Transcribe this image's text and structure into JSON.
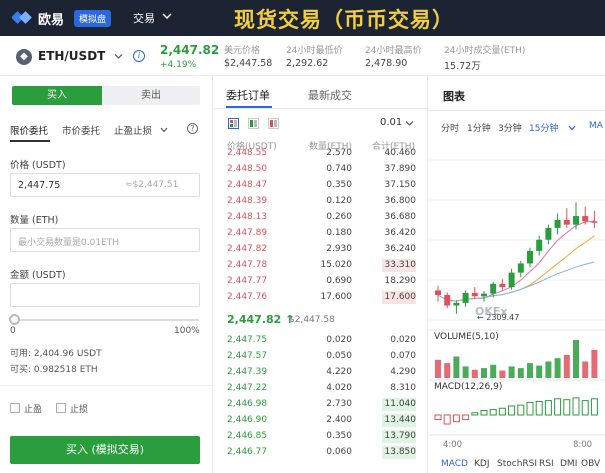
{
  "app": {
    "logo_text": "欧易",
    "demo_badge": "模拟盘",
    "nav_trade": "交易",
    "banner_title": "现货交易（币币交易）"
  },
  "ticker": {
    "pair": "ETH/USDT",
    "last_price": "2,447.82",
    "change_pct": "+4.19%",
    "stats": [
      {
        "label": "美元价格",
        "value": "$2,447.58"
      },
      {
        "label": "24小时最低价",
        "value": "2,292.62"
      },
      {
        "label": "24小时最高价",
        "value": "2,478.90"
      },
      {
        "label": "24小时成交量(ETH)",
        "value": "15.72万"
      }
    ]
  },
  "order_form": {
    "buy_tab": "买入",
    "sell_tab": "卖出",
    "order_types": [
      "限价委托",
      "市价委托",
      "止盈止损"
    ],
    "price_label": "价格 (USDT)",
    "price_value": "2,447.75",
    "price_approx": "≈$2,447.51",
    "amount_label": "数量 (ETH)",
    "amount_placeholder": "最小交易数量是0.01ETH",
    "total_label": "金额 (USDT)",
    "slider_min": "0",
    "slider_max": "100%",
    "slider_position": 0,
    "available": "可用: 2,404.96 USDT",
    "can_buy": "可买: 0.982518 ETH",
    "take_profit": "止盈",
    "stop_loss": "止损",
    "buy_button": "买入 (模拟交易)"
  },
  "orderbook": {
    "tab_orders": "委托订单",
    "tab_trades": "最新成交",
    "tick_size": "0.01",
    "headers": [
      "价格(USDT)",
      "数量(ETH)",
      "合计(ETH)"
    ],
    "asks": [
      {
        "price": "2,448.55",
        "size": "2.570",
        "total": "40.460"
      },
      {
        "price": "2,448.50",
        "size": "0.740",
        "total": "37.890"
      },
      {
        "price": "2,448.47",
        "size": "0.350",
        "total": "37.150"
      },
      {
        "price": "2,448.39",
        "size": "0.120",
        "total": "36.800"
      },
      {
        "price": "2,448.13",
        "size": "0.260",
        "total": "36.680"
      },
      {
        "price": "2,447.89",
        "size": "0.180",
        "total": "36.420"
      },
      {
        "price": "2,447.82",
        "size": "2.930",
        "total": "36.240"
      },
      {
        "price": "2,447.78",
        "size": "15.020",
        "total": "33.310"
      },
      {
        "price": "2,447.77",
        "size": "0.690",
        "total": "18.290"
      },
      {
        "price": "2,447.76",
        "size": "17.600",
        "total": "17.600"
      }
    ],
    "mid_price": "2,447.82 ↑",
    "mid_usd": "$2,447.58",
    "bids": [
      {
        "price": "2,447.75",
        "size": "0.020",
        "total": "0.020"
      },
      {
        "price": "2,447.57",
        "size": "0.050",
        "total": "0.070"
      },
      {
        "price": "2,447.39",
        "size": "4.220",
        "total": "4.290"
      },
      {
        "price": "2,447.22",
        "size": "4.020",
        "total": "8.310"
      },
      {
        "price": "2,446.98",
        "size": "2.730",
        "total": "11.040"
      },
      {
        "price": "2,446.90",
        "size": "2.400",
        "total": "13.440"
      },
      {
        "price": "2,446.85",
        "size": "0.350",
        "total": "13.790"
      },
      {
        "price": "2,446.77",
        "size": "0.060",
        "total": "13.850"
      }
    ]
  },
  "chart": {
    "title": "图表",
    "intervals": [
      "分时",
      "1分钟",
      "3分钟",
      "15分钟",
      "MA"
    ],
    "active_interval": "15分钟",
    "low_label": "← 2309.47",
    "watermark": "OKEx",
    "volume_label": "VOLUME(5,10)",
    "macd_label": "MACD(12,26,9)",
    "time_labels": [
      "4:00",
      "8:00"
    ],
    "indicator_tabs": [
      "MACD",
      "KDJ",
      "StochRSI",
      "RSI",
      "DMI",
      "OBV"
    ],
    "colors": {
      "up": "#2a9d3c",
      "down": "#e0505b",
      "accent": "#2c68dd"
    },
    "candles": [
      {
        "o": 2345,
        "h": 2352,
        "l": 2328,
        "c": 2338
      },
      {
        "o": 2338,
        "h": 2342,
        "l": 2318,
        "c": 2322
      },
      {
        "o": 2322,
        "h": 2330,
        "l": 2309.47,
        "c": 2326
      },
      {
        "o": 2326,
        "h": 2345,
        "l": 2320,
        "c": 2341
      },
      {
        "o": 2341,
        "h": 2350,
        "l": 2332,
        "c": 2336
      },
      {
        "o": 2336,
        "h": 2344,
        "l": 2328,
        "c": 2340
      },
      {
        "o": 2340,
        "h": 2358,
        "l": 2334,
        "c": 2355
      },
      {
        "o": 2355,
        "h": 2362,
        "l": 2345,
        "c": 2350
      },
      {
        "o": 2350,
        "h": 2378,
        "l": 2346,
        "c": 2372
      },
      {
        "o": 2372,
        "h": 2390,
        "l": 2365,
        "c": 2386
      },
      {
        "o": 2386,
        "h": 2410,
        "l": 2380,
        "c": 2405
      },
      {
        "o": 2405,
        "h": 2428,
        "l": 2398,
        "c": 2422
      },
      {
        "o": 2422,
        "h": 2445,
        "l": 2415,
        "c": 2440
      },
      {
        "o": 2440,
        "h": 2462,
        "l": 2430,
        "c": 2452
      },
      {
        "o": 2452,
        "h": 2470,
        "l": 2440,
        "c": 2445
      },
      {
        "o": 2445,
        "h": 2478.9,
        "l": 2438,
        "c": 2458
      },
      {
        "o": 2458,
        "h": 2472,
        "l": 2445,
        "c": 2450
      },
      {
        "o": 2450,
        "h": 2466,
        "l": 2440,
        "c": 2447.82
      }
    ],
    "volumes": [
      22,
      18,
      26,
      14,
      10,
      12,
      16,
      9,
      14,
      12,
      18,
      15,
      20,
      24,
      28,
      46,
      20,
      34
    ],
    "macd_hist": [
      -1,
      -2,
      -1.5,
      -1,
      0.5,
      1,
      1.2,
      1.5,
      2,
      2.2,
      2.8,
      3,
      3.2,
      3.6,
      3.4,
      3.8,
      3.2,
      3.6
    ]
  }
}
